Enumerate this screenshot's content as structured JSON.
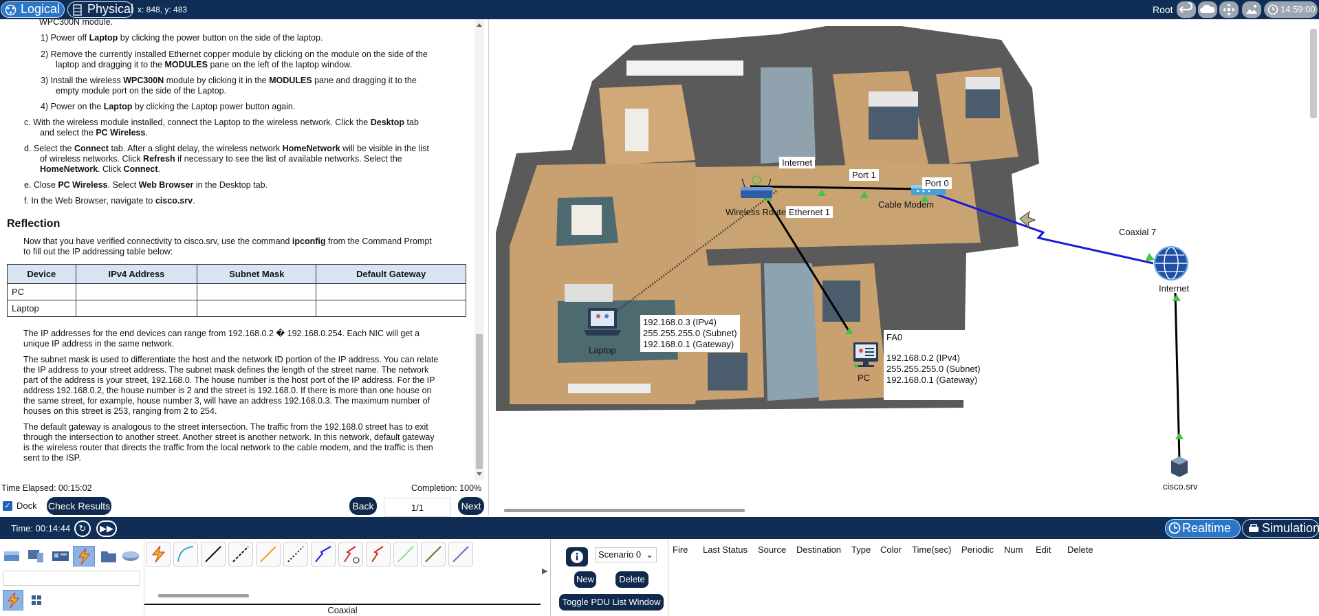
{
  "topbar": {
    "logical_label": "Logical",
    "physical_label": "Physical",
    "coords": "x: 848, y: 483",
    "root_label": "Root",
    "clock": "14:59:00"
  },
  "instructions": {
    "line0": "WPC300N module.",
    "step1_pre": "1)  Power off ",
    "step1_b": "Laptop",
    "step1_post": " by clicking the power button on the side of the laptop.",
    "step2_line1": "2)  Remove the currently installed Ethernet copper module by clicking on the module on the side of the",
    "step2_line2_pre": "laptop and dragging it to the ",
    "step2_line2_b": "MODULES",
    "step2_line2_post": " pane on the left of the laptop window.",
    "step3_line1_pre": "3)  Install the wireless ",
    "step3_line1_b1": "WPC300N",
    "step3_line1_mid": " module by clicking it in the ",
    "step3_line1_b2": "MODULES",
    "step3_line1_post": " pane and dragging it to the",
    "step3_line2": "empty module port on the side of the Laptop.",
    "step4_pre": "4)  Power on the ",
    "step4_b": "Laptop",
    "step4_post": " by clicking the Laptop power button again.",
    "c_line1_pre": "c.   With the wireless module installed, connect the Laptop to the wireless network. Click the ",
    "c_line1_b": "Desktop",
    "c_line1_post": " tab",
    "c_line2_pre": "and select the ",
    "c_line2_b": "PC Wireless",
    "c_line2_post": ".",
    "d_line1_pre": "d.   Select the ",
    "d_line1_b1": "Connect",
    "d_line1_mid": " tab. After a slight delay, the wireless network ",
    "d_line1_b2": "HomeNetwork",
    "d_line1_post": " will be visible in the list",
    "d_line2_pre": "of wireless networks. Click ",
    "d_line2_b": "Refresh",
    "d_line2_post": " if necessary to see the list of available networks. Select the",
    "d_line3_b1": "HomeNetwork",
    "d_line3_mid": ". Click ",
    "d_line3_b2": "Connect",
    "d_line3_post": ".",
    "e_pre": "e.   Close ",
    "e_b1": "PC Wireless",
    "e_mid": ". Select ",
    "e_b2": "Web Browser",
    "e_post": " in the Desktop tab.",
    "f_pre": "f.    In the Web Browser, navigate to ",
    "f_b": "cisco.srv",
    "f_post": ".",
    "reflection_heading": "Reflection",
    "refl_line1_pre": "Now that you have verified connectivity to cisco.srv, use the command ",
    "refl_line1_b": "ipconfig",
    "refl_line1_post": " from the Command Prompt",
    "refl_line2": "to fill out the IP addressing table below:",
    "table": {
      "headers": [
        "Device",
        "IPv4 Address",
        "Subnet Mask",
        "Default Gateway"
      ],
      "rows": [
        [
          "PC",
          "",
          "",
          ""
        ],
        [
          "Laptop",
          "",
          "",
          ""
        ]
      ]
    },
    "p1_line1": "The IP addresses for the end devices can range from 192.168.0.2 � 192.168.0.254. Each NIC will get a",
    "p1_line2": "unique IP address in the same network.",
    "p2_line1": "The subnet mask is used to differentiate the host and the network ID portion of the IP address. You can relate",
    "p2_line2": "the IP address to your street address. The subnet mask defines the length of the street name. The network",
    "p2_line3": "part of the address is your street, 192.168.0. The house number is the host port of the IP address. For the IP",
    "p2_line4": "address 192.168.0.2, the house number is 2 and the street is 192.168.0. If there is more than one house on",
    "p2_line5": "the same street, for example, house number 3, will have an address 192.168.0.3. The maximum number of",
    "p2_line6": "houses on this street is 253, ranging from 2 to 254.",
    "p3_line1": "The default gateway is analogous to the street intersection. The traffic from the 192.168.0 street has to exit",
    "p3_line2": "through the intersection to another street. Another street is another network. In this network, default gateway",
    "p3_line3": "is the wireless router that directs the traffic from the local network to the cable modem, and the traffic is then",
    "p3_line4": "sent to the ISP."
  },
  "status": {
    "time_elapsed": "Time Elapsed: 00:15:02",
    "completion": "Completion: 100%"
  },
  "controls": {
    "dock_label": "Dock",
    "check_results": "Check Results",
    "back": "Back",
    "page": "1/1",
    "next": "Next"
  },
  "workspace": {
    "labels": {
      "internet_tag": "Internet",
      "port1": "Port 1",
      "port0": "Port 0",
      "cable_modem": "Cable Modem",
      "wireless_router": "Wireless Router",
      "ethernet1": "Ethernet 1",
      "coaxial7": "Coaxial 7",
      "internet_cloud": "Internet",
      "laptop": "Laptop",
      "pc": "PC",
      "fa0": "FA0",
      "cisco_srv": "cisco.srv"
    },
    "laptop_info": [
      "192.168.0.3 (IPv4)",
      "255.255.255.0 (Subnet)",
      "192.168.0.1 (Gateway)"
    ],
    "pc_info": [
      "192.168.0.2 (IPv4)",
      "255.255.255.0 (Subnet)",
      "192.168.0.1 (Gateway)"
    ],
    "colors": {
      "coax_link": "#1a1adb",
      "ethernet_link": "#000000",
      "link_up": "#44c444"
    }
  },
  "bottombar": {
    "time": "Time: 00:14:44",
    "realtime": "Realtime",
    "simulation": "Simulation"
  },
  "palette": {
    "connection_name": "Coaxial",
    "scenario": "Scenario 0",
    "new_button": "New",
    "delete_button": "Delete",
    "toggle_pdu": "Toggle PDU List Window",
    "pdu_columns": [
      "Fire",
      "Last Status",
      "Source",
      "Destination",
      "Type",
      "Color",
      "Time(sec)",
      "Periodic",
      "Num",
      "Edit",
      "Delete"
    ]
  }
}
